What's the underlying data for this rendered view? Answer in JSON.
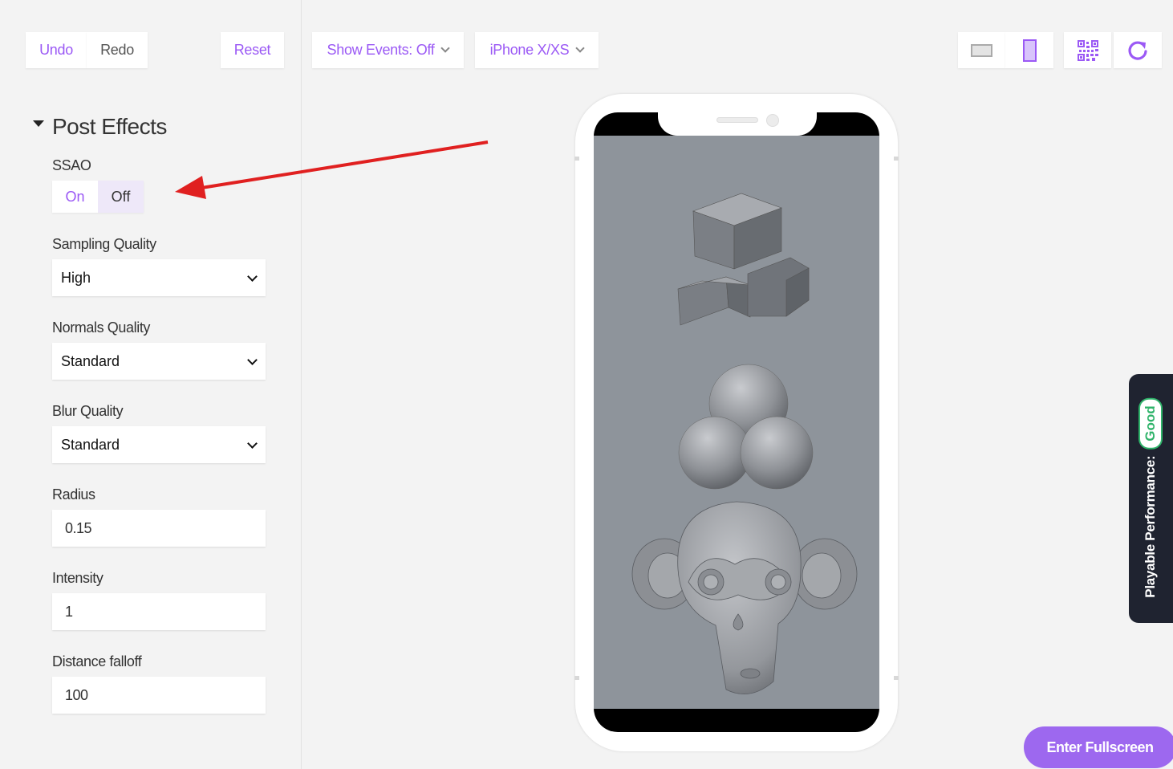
{
  "toolbar": {
    "undo_label": "Undo",
    "redo_label": "Redo",
    "reset_label": "Reset",
    "show_events_label": "Show Events: Off",
    "device_label": "iPhone X/XS"
  },
  "sidebar": {
    "section_title": "Post Effects",
    "ssao": {
      "label": "SSAO",
      "on_label": "On",
      "off_label": "Off",
      "selected": "Off"
    },
    "sampling_quality": {
      "label": "Sampling Quality",
      "value": "High"
    },
    "normals_quality": {
      "label": "Normals Quality",
      "value": "Standard"
    },
    "blur_quality": {
      "label": "Blur Quality",
      "value": "Standard"
    },
    "radius": {
      "label": "Radius",
      "value": "0.15"
    },
    "intensity": {
      "label": "Intensity",
      "value": "1"
    },
    "distance_falloff": {
      "label": "Distance falloff",
      "value": "100"
    }
  },
  "performance": {
    "label": "Playable Performance:",
    "status": "Good",
    "status_color": "#2fb36a"
  },
  "fullscreen_label": "Enter Fullscreen",
  "colors": {
    "accent": "#9b59f5",
    "annotation_arrow": "#e02020"
  },
  "icons": [
    "landscape-orientation-icon",
    "portrait-orientation-icon",
    "qr-code-icon",
    "refresh-icon",
    "chevron-down-icon"
  ]
}
